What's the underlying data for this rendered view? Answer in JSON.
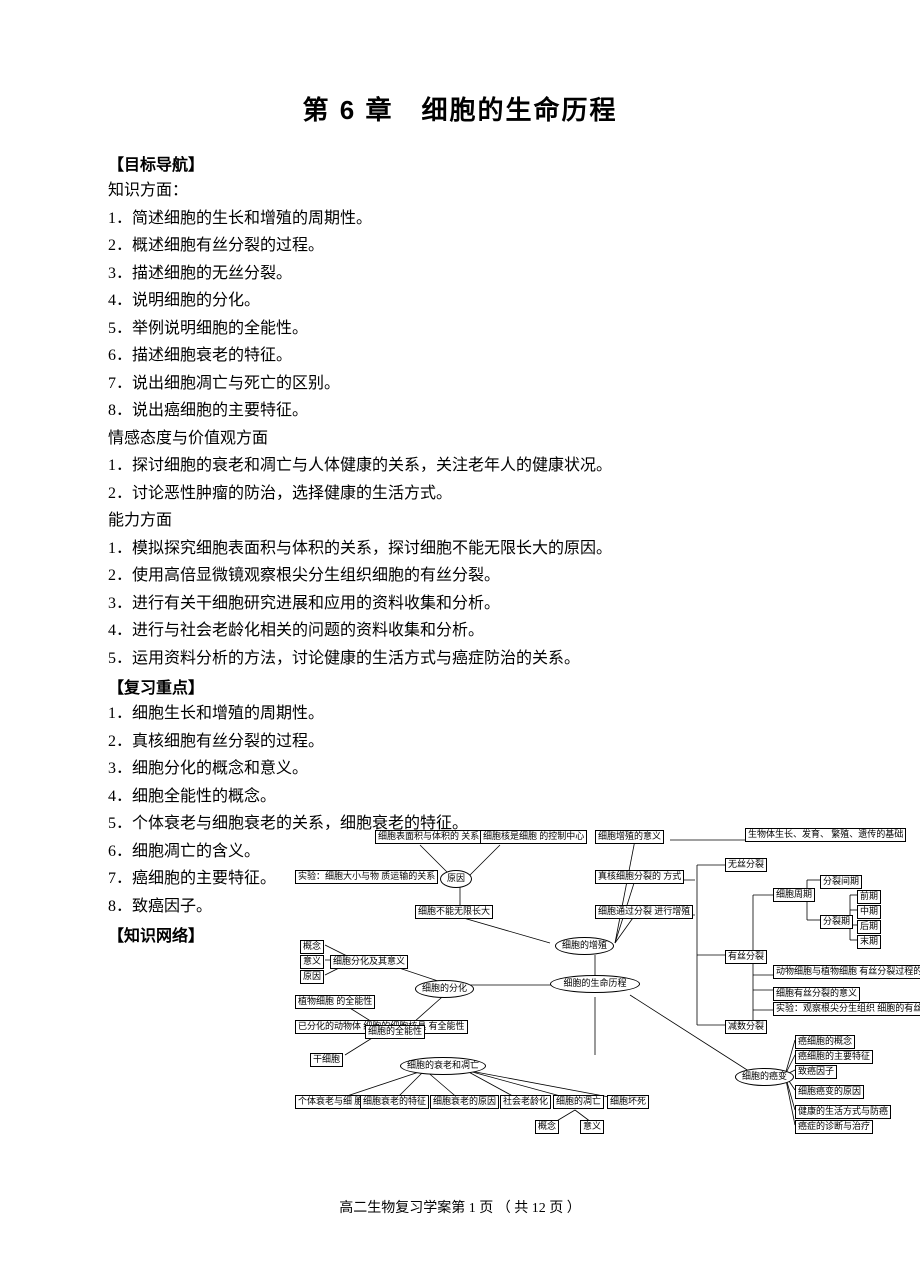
{
  "title": "第 6 章　细胞的生命历程",
  "sections": {
    "goals_head": "【目标导航】",
    "knowledge_head": "知识方面：",
    "knowledge": [
      "1．简述细胞的生长和增殖的周期性。",
      "2．概述细胞有丝分裂的过程。",
      "3．描述细胞的无丝分裂。",
      "4．说明细胞的分化。",
      "5．举例说明细胞的全能性。",
      "6．描述细胞衰老的特征。",
      "7．说出细胞凋亡与死亡的区别。",
      "8．说出癌细胞的主要特征。"
    ],
    "attitude_head": "情感态度与价值观方面",
    "attitude": [
      "1．探讨细胞的衰老和凋亡与人体健康的关系，关注老年人的健康状况。",
      "2．讨论恶性肿瘤的防治，选择健康的生活方式。"
    ],
    "ability_head": "能力方面",
    "ability": [
      "1．模拟探究细胞表面积与体积的关系，探讨细胞不能无限长大的原因。",
      "2．使用高倍显微镜观察根尖分生组织细胞的有丝分裂。",
      "3．进行有关干细胞研究进展和应用的资料收集和分析。",
      "4．进行与社会老龄化相关的问题的资料收集和分析。",
      "5．运用资料分析的方法，讨论健康的生活方式与癌症防治的关系。"
    ],
    "review_head": "【复习重点】",
    "review": [
      "1．细胞生长和增殖的周期性。",
      "2．真核细胞有丝分裂的过程。",
      "3．细胞分化的概念和意义。",
      "4．细胞全能性的概念。",
      "5．个体衰老与细胞衰老的关系，细胞衰老的特征。",
      "6．细胞凋亡的含义。",
      "7．癌细胞的主要特征。",
      "8．致癌因子。"
    ],
    "network_head": "【知识网络】"
  },
  "diagram": {
    "center": "细胞的生命历程",
    "top": {
      "n1": "细胞表面积与体积的\n关系限制细胞的长大",
      "n2": "细胞核是细胞\n的控制中心",
      "n3": "实验：细胞大小与物\n质运输的关系",
      "n4": "原因",
      "n5": "细胞不能无限长大",
      "n6": "细胞的增殖",
      "n7": "细胞增殖的意义",
      "n8": "真核细胞分裂的\n方式",
      "n9": "细胞通过分裂\n进行增殖",
      "r1": "生物体生长、发育、\n繁殖、遗传的基础",
      "r2": "无丝分裂",
      "r3": "有丝分裂",
      "r4": "减数分裂",
      "r5": "细胞周期",
      "r6": "分裂间期",
      "r7": "分裂期",
      "r8": "前期",
      "r9": "中期",
      "r10": "后期",
      "r11": "末期",
      "r12": "动物细胞与植物细胞\n有丝分裂过程的区别",
      "r13": "细胞有丝分裂的意义",
      "r14": "实验：观察根尖分生组织\n细胞的有丝分裂"
    },
    "left": {
      "l1": "概念",
      "l2": "意义",
      "l3": "原因",
      "l4": "细胞分化及其意义",
      "l5": "细胞的分化",
      "l6": "植物细胞\n的全能性",
      "l7": "已分化的动物体\n细胞的细胞核具\n有全能性",
      "l8": "干细胞",
      "l9": "细胞的全能性"
    },
    "bottom": {
      "b0": "细胞的衰老和凋亡",
      "b1": "个体衰老与细\n胞衰老的关系",
      "b2": "细胞衰老的特征",
      "b3": "细胞衰老的原因",
      "b4": "社会老龄化",
      "b5": "细胞的凋亡",
      "b6": "细胞坏死",
      "b7": "概念",
      "b8": "意义"
    },
    "cancer": {
      "c0": "细胞的癌变",
      "c1": "癌细胞的概念",
      "c2": "癌细胞的主要特征",
      "c3": "致癌因子",
      "c4": "细胞癌变的原因",
      "c5": "健康的生活方式与防癌",
      "c6": "癌症的诊断与治疗"
    }
  },
  "footer": "高二生物复习学案第 1 页 （ 共 12 页 ）"
}
